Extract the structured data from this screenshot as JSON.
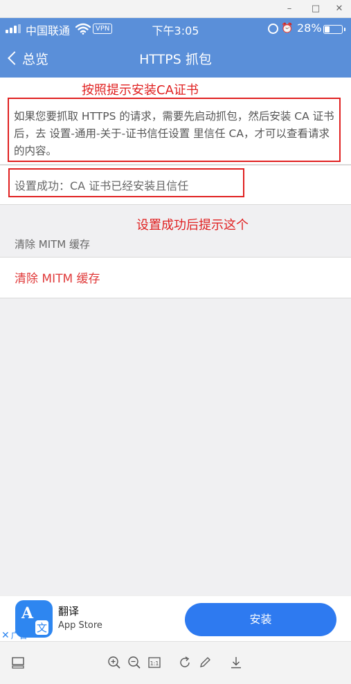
{
  "window": {
    "minimize": "–",
    "maximize": "□",
    "close": "✕"
  },
  "status_bar": {
    "carrier": "中国联通",
    "vpn": "VPN",
    "time": "下午3:05",
    "battery": "28%",
    "battery_level": 0.28
  },
  "nav": {
    "back_label": "总览",
    "title": "HTTPS 抓包"
  },
  "annotations": {
    "install_hint": "按照提示安装CA证书",
    "success_hint": "设置成功后提示这个"
  },
  "content": {
    "description": "如果您要抓取 HTTPS 的请求，需要先启动抓包，然后安装 CA 证书后，去 设置-通用-关于-证书信任设置 里信任 CA，才可以查看请求的内容。",
    "success_text": "设置成功：CA 证书已经安装且信任",
    "section_header": "清除 MITM 缓存",
    "clear_button": "清除 MITM 缓存"
  },
  "ad": {
    "icon_letter": "A",
    "icon_char": "文",
    "app_name": "翻译",
    "store": "App Store",
    "ad_label": "广告",
    "install": "安装"
  },
  "colors": {
    "nav_blue": "#5a8fd9",
    "annotation_red": "#e02020",
    "clear_red": "#e03a3a",
    "install_blue": "#2e7af0"
  }
}
